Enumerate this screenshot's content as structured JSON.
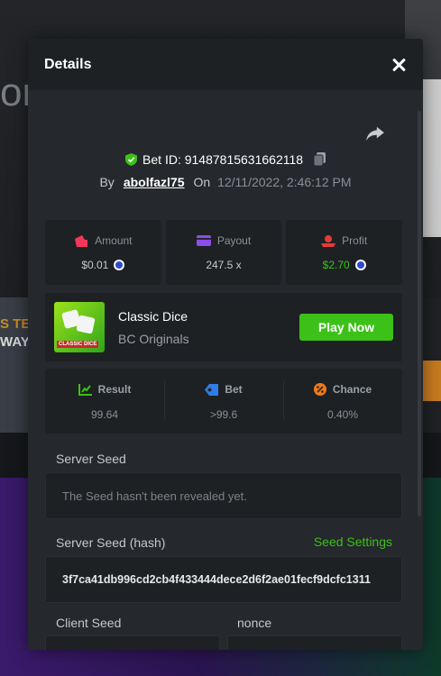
{
  "background": {
    "big_text": "or",
    "side_line_1": "S TE",
    "side_line_2": "WAY"
  },
  "modal": {
    "title": "Details",
    "bet_id_label": "Bet ID: 91487815631662118",
    "by_label": "By",
    "username": "abolfazl75",
    "on_label": "On",
    "date": "12/11/2022, 2:46:12 PM"
  },
  "stats": {
    "amount": {
      "label": "Amount",
      "value": "$0.01"
    },
    "payout": {
      "label": "Payout",
      "value": "247.5 x"
    },
    "profit": {
      "label": "Profit",
      "value": "$2.70"
    }
  },
  "game": {
    "name": "Classic Dice",
    "provider": "BC Originals",
    "thumb_label": "CLASSIC DICE",
    "play_label": "Play Now"
  },
  "result": {
    "result": {
      "label": "Result",
      "value": "99.64"
    },
    "bet": {
      "label": "Bet",
      "value": ">99.6"
    },
    "chance": {
      "label": "Chance",
      "value": "0.40%"
    }
  },
  "seeds": {
    "server_seed_label": "Server Seed",
    "server_seed_value": "The Seed hasn't been revealed yet.",
    "server_hash_label": "Server Seed (hash)",
    "seed_settings_label": "Seed Settings",
    "server_hash_value": "3f7ca41db996cd2cb4f433444dece2d6f2ae01fecf9dcfc1311",
    "client_seed_label": "Client Seed",
    "nonce_label": "nonce"
  },
  "colors": {
    "accent_green": "#3bc117",
    "modal_bg": "#25282c",
    "panel_bg": "#1e2124"
  }
}
